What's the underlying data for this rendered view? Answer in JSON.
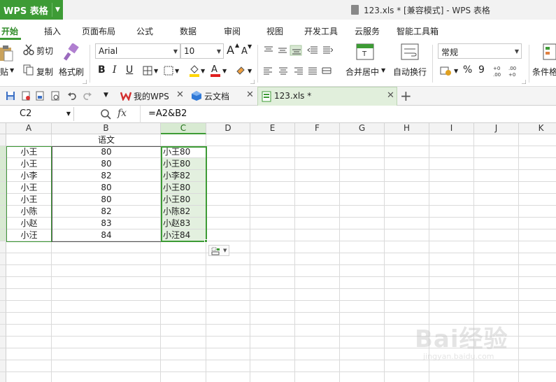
{
  "titlebar": {
    "app_name": "WPS 表格",
    "window_title": "123.xls * [兼容模式] - WPS 表格"
  },
  "menu": {
    "tabs": [
      "开始",
      "插入",
      "页面布局",
      "公式",
      "数据",
      "审阅",
      "视图",
      "开发工具",
      "云服务",
      "智能工具箱"
    ]
  },
  "ribbon": {
    "paste_label": "贴",
    "cut_label": "剪切",
    "copy_label": "复制",
    "format_painter_label": "格式刷",
    "font_name": "Arial",
    "font_size": "10",
    "number_format": "常规",
    "merge_label": "合并居中",
    "wrap_label": "自动换行",
    "conditional_label": "条件格",
    "percent_symbol": "%",
    "comma_symbol": "9",
    "bold": "B",
    "italic": "I",
    "underline": "U",
    "grow_font": "A",
    "shrink_font": "A"
  },
  "doc_tabs": [
    {
      "label": "我的WPS"
    },
    {
      "label": "云文档"
    },
    {
      "label": "123.xls *"
    }
  ],
  "formula_bar": {
    "cell_ref": "C2",
    "fx_label": "fx",
    "formula": "=A2&B2"
  },
  "sheet": {
    "columns": [
      "A",
      "B",
      "C",
      "D",
      "E",
      "F",
      "G",
      "H",
      "I",
      "J",
      "K"
    ],
    "header_row": {
      "B": "语文"
    },
    "rows": [
      {
        "A": "小王",
        "B": "80",
        "C": "小王80"
      },
      {
        "A": "小王",
        "B": "80",
        "C": "小王80"
      },
      {
        "A": "小李",
        "B": "82",
        "C": "小李82"
      },
      {
        "A": "小王",
        "B": "80",
        "C": "小王80"
      },
      {
        "A": "小王",
        "B": "80",
        "C": "小王80"
      },
      {
        "A": "小陈",
        "B": "82",
        "C": "小陈82"
      },
      {
        "A": "小赵",
        "B": "83",
        "C": "小赵83"
      },
      {
        "A": "小汪",
        "B": "84",
        "C": "小汪84"
      }
    ]
  },
  "watermark": {
    "main": "Bai经验",
    "sub": "jingyan.baidu.com"
  },
  "colors": {
    "accent": "#3d9b35",
    "selection_fill": "#e3f0df",
    "header_bg": "#f3f3f3"
  }
}
